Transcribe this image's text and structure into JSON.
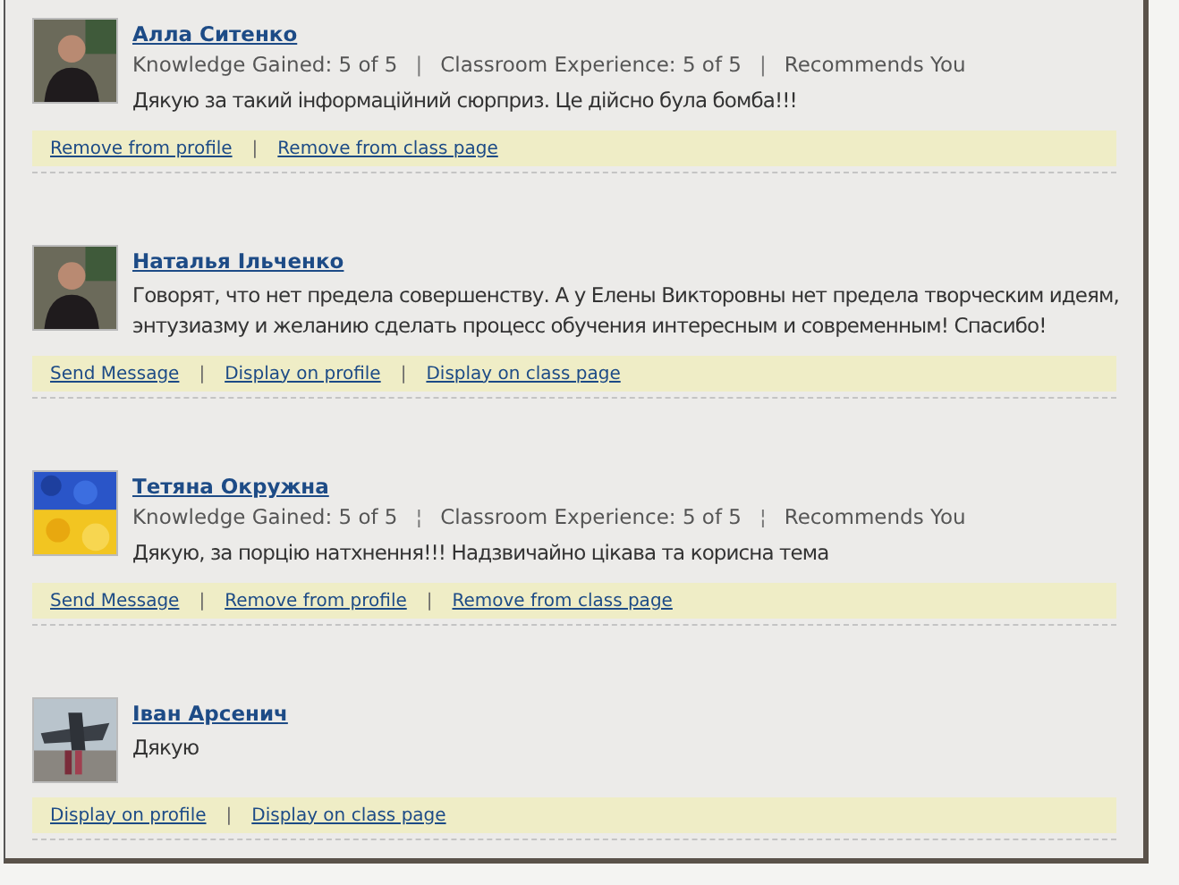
{
  "reviews": [
    {
      "name": "Алла Ситенко",
      "meta": [
        "Knowledge Gained: 5 of 5",
        "Classroom Experience: 5 of 5",
        "Recommends You"
      ],
      "meta_separator": "|",
      "text": "Дякую за такий інформаційний сюрприз. Це дійсно була бомба!!!",
      "actions": [
        "Remove from profile",
        "Remove from class page"
      ],
      "action_separator": "|"
    },
    {
      "name": "Наталья Ільченко",
      "text": "Говорят, что нет предела совершенству. А у Елены Викторовны нет предела творческим идеям, энтузиазму и желанию сделать процесс обучения интересным и современным! Спасибо!",
      "actions": [
        "Send Message",
        "Display on profile",
        "Display on class page"
      ],
      "action_separator": "|"
    },
    {
      "name": "Тетяна Окружна",
      "meta": [
        "Knowledge Gained: 5 of 5",
        "Classroom Experience: 5 of 5",
        "Recommends You"
      ],
      "meta_separator": "¦",
      "text": "Дякую, за порцію натхнення!!! Надзвичайно цікава та корисна тема",
      "actions": [
        "Send Message",
        "Remove from profile",
        "Remove from class page"
      ],
      "action_separator": "|"
    },
    {
      "name": "Іван Арсенич",
      "text": "Дякую",
      "actions": [
        "Display on profile",
        "Display on class page"
      ],
      "action_separator": "|"
    }
  ]
}
